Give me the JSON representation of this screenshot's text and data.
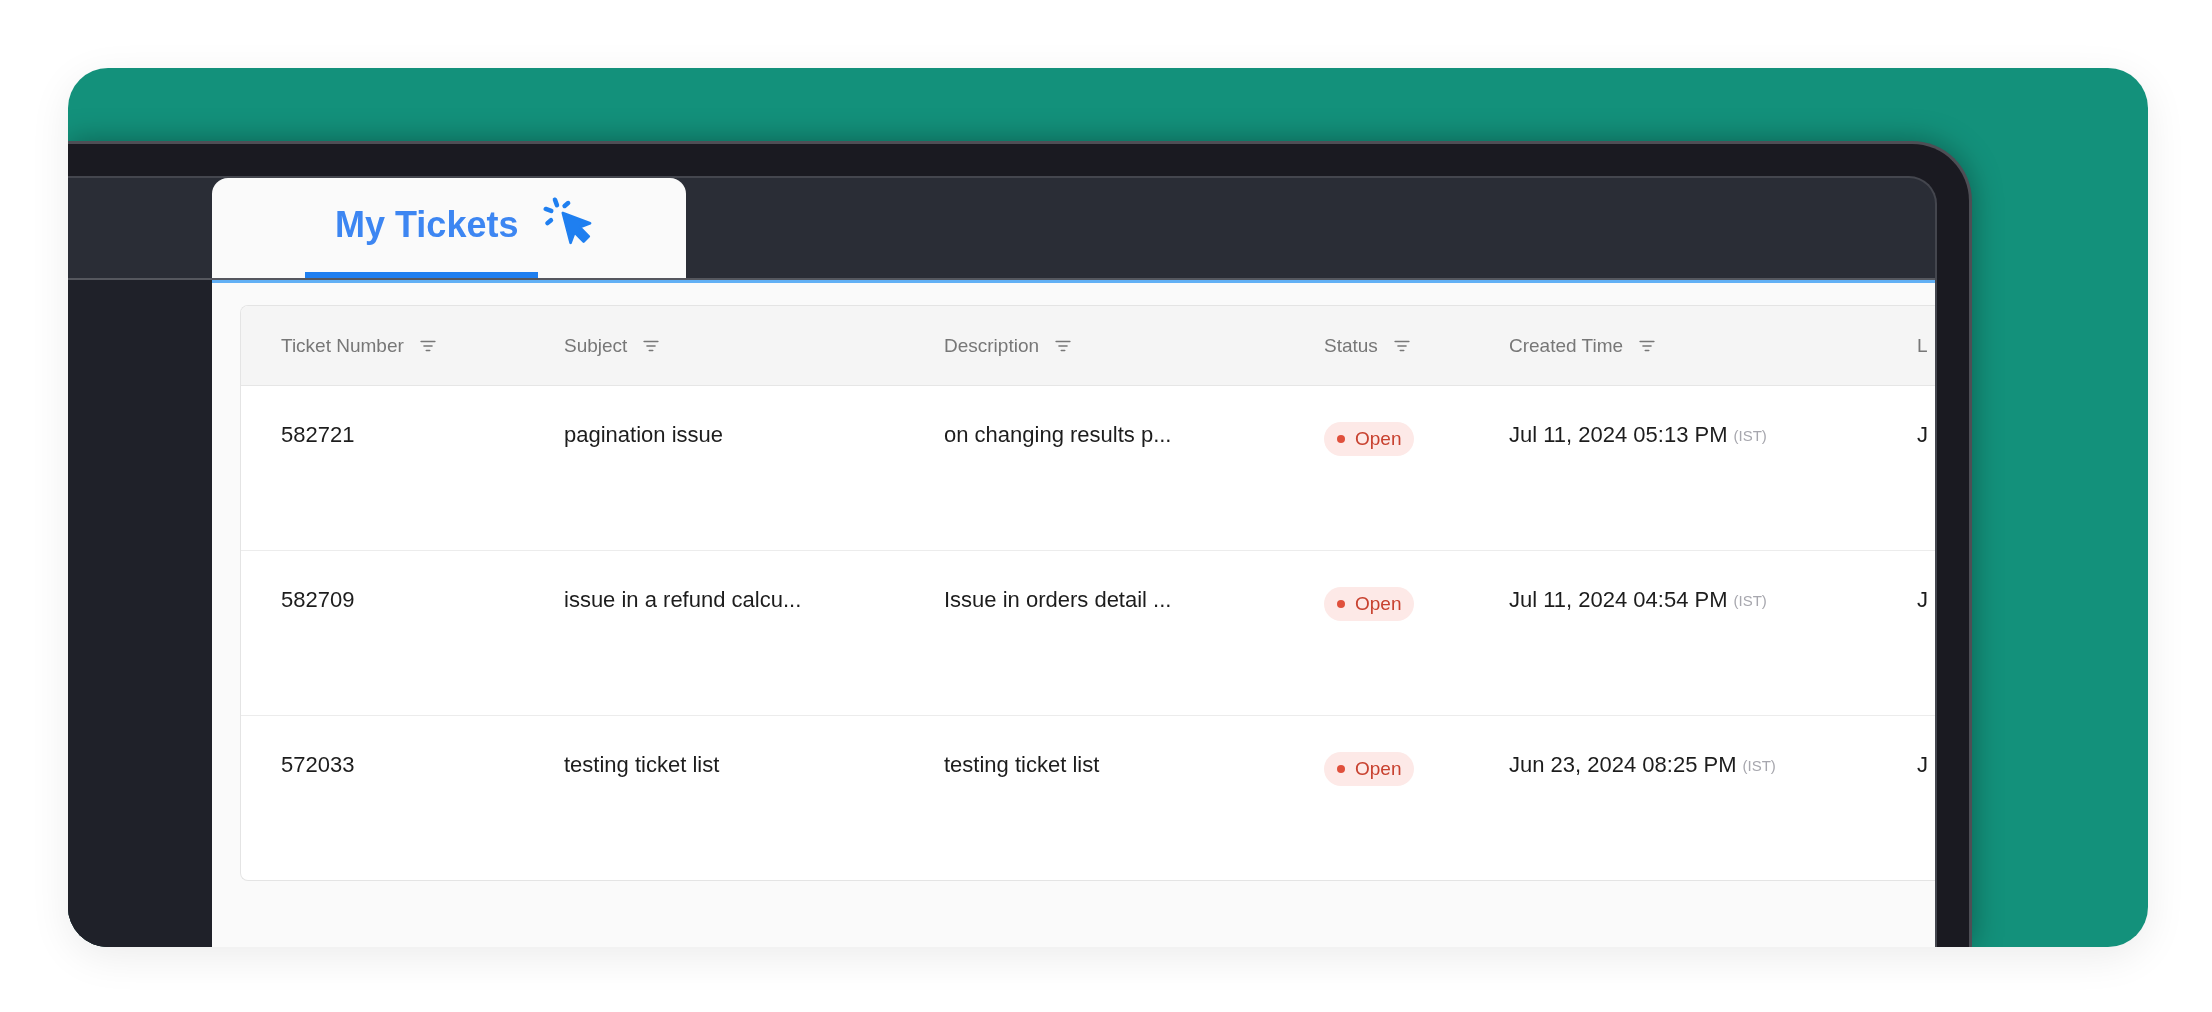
{
  "tabs": [
    {
      "label": "My Tickets",
      "selected": true
    }
  ],
  "table": {
    "columns": [
      {
        "label": "Ticket Number",
        "filterable": true
      },
      {
        "label": "Subject",
        "filterable": true
      },
      {
        "label": "Description",
        "filterable": true
      },
      {
        "label": "Status",
        "filterable": true
      },
      {
        "label": "Created Time",
        "filterable": true
      },
      {
        "label": "L",
        "filterable": false
      }
    ],
    "rows": [
      {
        "ticket_number": "582721",
        "subject": "pagination issue",
        "description": "on changing results p...",
        "status": {
          "label": "Open",
          "kind": "open"
        },
        "created": {
          "time": "Jul 11, 2024 05:13 PM",
          "zone": "(IST)"
        },
        "column_6": "J"
      },
      {
        "ticket_number": "582709",
        "subject": "issue in a refund calcu...",
        "description": "Issue in orders detail ...",
        "status": {
          "label": "Open",
          "kind": "open"
        },
        "created": {
          "time": "Jul 11, 2024 04:54 PM",
          "zone": "(IST)"
        },
        "column_6": "J"
      },
      {
        "ticket_number": "572033",
        "subject": "testing ticket list",
        "description": "testing ticket list",
        "status": {
          "label": "Open",
          "kind": "open"
        },
        "created": {
          "time": "Jun 23, 2024 08:25 PM",
          "zone": "(IST)"
        },
        "column_6": "J"
      }
    ]
  }
}
